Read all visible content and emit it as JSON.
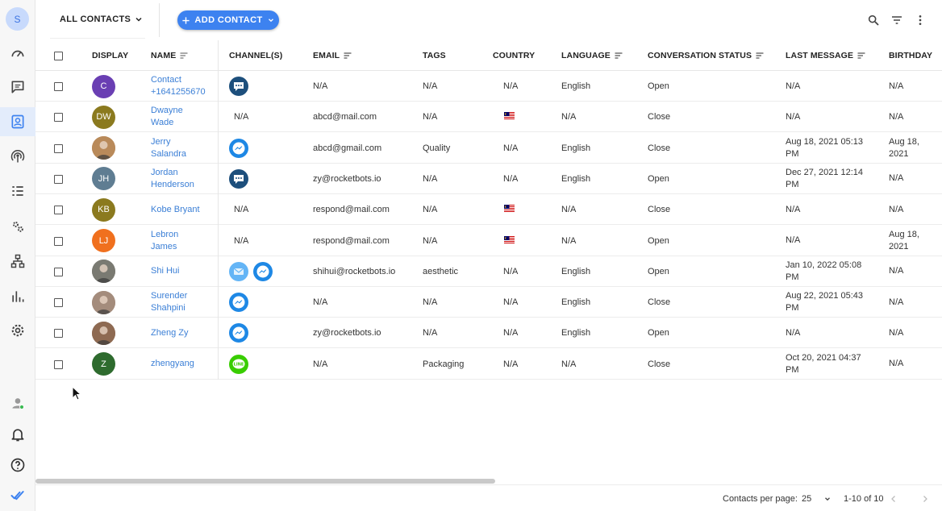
{
  "sidebar": {
    "avatar_letter": "S",
    "items": [
      {
        "name": "dashboard",
        "icon": "speedometer-icon"
      },
      {
        "name": "inbox",
        "icon": "chat-icon"
      },
      {
        "name": "contacts",
        "icon": "contacts-icon",
        "active": true
      },
      {
        "name": "broadcast",
        "icon": "broadcast-icon"
      },
      {
        "name": "tasks",
        "icon": "checklist-icon"
      },
      {
        "name": "automation",
        "icon": "gears-icon"
      },
      {
        "name": "workflow",
        "icon": "hierarchy-icon"
      },
      {
        "name": "reports",
        "icon": "bar-chart-icon"
      },
      {
        "name": "settings",
        "icon": "settings-icon"
      }
    ],
    "bottom": [
      "user-status-icon",
      "bell-icon",
      "help-icon",
      "logo-icon"
    ]
  },
  "topbar": {
    "filter_label": "ALL CONTACTS",
    "add_label": "ADD CONTACT"
  },
  "columns": {
    "display": "DISPLAY",
    "name": "NAME",
    "channels": "CHANNEL(S)",
    "email": "EMAIL",
    "tags": "TAGS",
    "country": "COUNTRY",
    "language": "LANGUAGE",
    "status": "CONVERSATION STATUS",
    "last_message": "LAST MESSAGE",
    "birthday": "BIRTHDAY"
  },
  "colors": {
    "accent": "#3d82f0",
    "link": "#3b7fd6",
    "messenger": "#1e88e5",
    "line": "#39cd00",
    "chat": "#1d4f7c"
  },
  "rows": [
    {
      "initials": "C",
      "avatar_color": "#6a3fb3",
      "name1": "Contact",
      "name2": "+1641255670",
      "channels": [
        "chat"
      ],
      "email": "N/A",
      "tags": "N/A",
      "country": "N/A",
      "language": "English",
      "status": "Open",
      "last1": "N/A",
      "last2": "",
      "bday1": "N/A",
      "bday2": ""
    },
    {
      "initials": "DW",
      "avatar_color": "#8b7a1f",
      "name1": "Dwayne",
      "name2": "Wade",
      "channels": [],
      "channels_text": "N/A",
      "email": "abcd@mail.com",
      "tags": "N/A",
      "country": "flag",
      "language": "N/A",
      "status": "Close",
      "last1": "N/A",
      "last2": "",
      "bday1": "N/A",
      "bday2": ""
    },
    {
      "initials": "",
      "avatar_color": "#b98a5a",
      "photo": true,
      "name1": "Jerry",
      "name2": "Salandra",
      "channels": [
        "messenger"
      ],
      "email": "abcd@gmail.com",
      "tags": "Quality",
      "country": "N/A",
      "language": "English",
      "status": "Close",
      "last1": "Aug 18, 2021 05:13",
      "last2": "PM",
      "bday1": "Aug 18,",
      "bday2": "2021"
    },
    {
      "initials": "JH",
      "avatar_color": "#5f7d92",
      "name1": "Jordan",
      "name2": "Henderson",
      "channels": [
        "chat"
      ],
      "email": "zy@rocketbots.io",
      "tags": "N/A",
      "country": "N/A",
      "language": "English",
      "status": "Open",
      "last1": "Dec 27, 2021 12:14",
      "last2": "PM",
      "bday1": "N/A",
      "bday2": ""
    },
    {
      "initials": "KB",
      "avatar_color": "#8b7a1f",
      "name1": "Kobe Bryant",
      "name2": "",
      "channels": [],
      "channels_text": "N/A",
      "email": "respond@mail.com",
      "tags": "N/A",
      "country": "flag",
      "language": "N/A",
      "status": "Close",
      "last1": "N/A",
      "last2": "",
      "bday1": "N/A",
      "bday2": ""
    },
    {
      "initials": "LJ",
      "avatar_color": "#f0701e",
      "name1": "Lebron",
      "name2": "James",
      "channels": [],
      "channels_text": "N/A",
      "email": "respond@mail.com",
      "tags": "N/A",
      "country": "flag",
      "language": "N/A",
      "status": "Open",
      "last1": "N/A",
      "last2": "",
      "bday1": "Aug 18,",
      "bday2": "2021"
    },
    {
      "initials": "",
      "avatar_color": "#7a7a72",
      "photo": true,
      "name1": "Shi Hui",
      "name2": "",
      "channels": [
        "email",
        "messenger"
      ],
      "email": "shihui@rocketbots.io",
      "tags": "aesthetic",
      "country": "N/A",
      "language": "English",
      "status": "Open",
      "last1": "Jan 10, 2022 05:08",
      "last2": "PM",
      "bday1": "N/A",
      "bday2": ""
    },
    {
      "initials": "",
      "avatar_color": "#a48c7c",
      "photo": true,
      "name1": "Surender",
      "name2": "Shahpini",
      "channels": [
        "messenger"
      ],
      "email": "N/A",
      "tags": "N/A",
      "country": "N/A",
      "language": "English",
      "status": "Close",
      "last1": "Aug 22, 2021 05:43",
      "last2": "PM",
      "bday1": "N/A",
      "bday2": ""
    },
    {
      "initials": "",
      "avatar_color": "#8e6a52",
      "photo": true,
      "name1": "Zheng Zy",
      "name2": "",
      "channels": [
        "messenger"
      ],
      "email": "zy@rocketbots.io",
      "tags": "N/A",
      "country": "N/A",
      "language": "English",
      "status": "Open",
      "last1": "N/A",
      "last2": "",
      "bday1": "N/A",
      "bday2": ""
    },
    {
      "initials": "Z",
      "avatar_color": "#2e6b2e",
      "name1": "zhengyang",
      "name2": "",
      "channels": [
        "line"
      ],
      "email": "N/A",
      "tags": "Packaging",
      "country": "N/A",
      "language": "N/A",
      "status": "Close",
      "last1": "Oct 20, 2021 04:37",
      "last2": "PM",
      "bday1": "N/A",
      "bday2": ""
    }
  ],
  "footer": {
    "per_page_label": "Contacts per page:",
    "per_page_value": "25",
    "range": "1-10 of 10"
  }
}
